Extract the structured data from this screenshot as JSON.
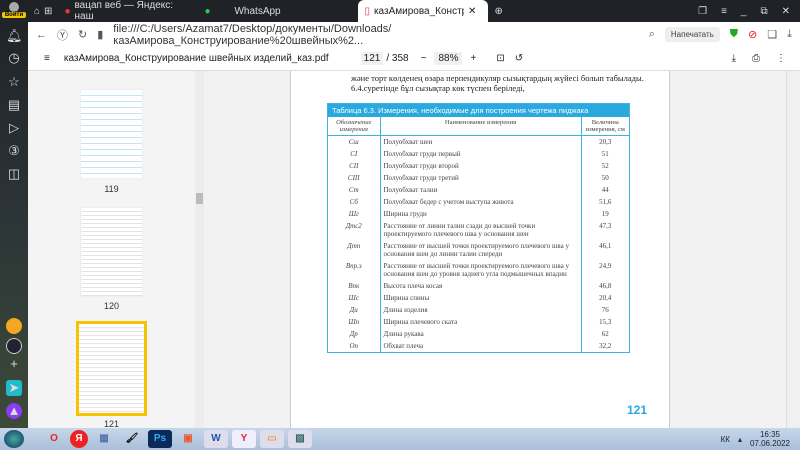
{
  "browser": {
    "login_label": "Войти",
    "tabs": [
      {
        "label": "вацап веб — Яндекс: наш"
      },
      {
        "label": "WhatsApp"
      },
      {
        "label": "казАмирова_Конструир"
      }
    ],
    "tab_count_badge": "3",
    "url": "file:///C:/Users/Azamat7/Desktop/документы/Downloads/казАмирова_Конструирование%20швейных%2...",
    "print_label": "Напечатать"
  },
  "pdf": {
    "filename": "казАмирова_Конструирование швейных изделий_каз.pdf",
    "page_current": "121",
    "page_total": "/ 358",
    "zoom": "88%"
  },
  "thumbnails": [
    {
      "label": "119"
    },
    {
      "label": "120"
    },
    {
      "label": "121",
      "selected": true
    }
  ],
  "page": {
    "text_line1": "және торт көлденең өзара перпендикуляр сызықтардың жүйесі болып табылады.",
    "text_line2": "6.4.суретінде бұл сызықтар көк түспен беріледі,",
    "table_caption": "Таблица 6.3. Измерения, необходимые для построения чертежа пиджака",
    "headers": [
      "Обозначение измерения",
      "Наименование измерения",
      "Величина измерения, см"
    ],
    "rows": [
      [
        "Сш",
        "Полуобхват шеи",
        "20,3"
      ],
      [
        "СI",
        "Полуобхват груди первый",
        "51"
      ],
      [
        "СII",
        "Полуобхват груди второй",
        "52"
      ],
      [
        "СIII",
        "Полуобхват груди третий",
        "50"
      ],
      [
        "Ст",
        "Полуобхват талии",
        "44"
      ],
      [
        "Сб",
        "Полуобхват бедер с учетом выступа живота",
        "51,6"
      ],
      [
        "Шг",
        "Ширина груди",
        "19"
      ],
      [
        "Дтс2",
        "Расстояние от линии талии сзади до высшей точки проектируемого плечевого шва у основания шеи",
        "47,3"
      ],
      [
        "Дтп",
        "Расстояние от высшей точки проектируемого плечевого шва у основания шеи до линии талии спереди",
        "46,1"
      ],
      [
        "Впр.з",
        "Расстояние от высшей точки проектируемого плечевого шва у основания шеи до уровня заднего угла подмышечных впадин",
        "24,9"
      ],
      [
        "Впк",
        "Высота плеча косая",
        "46,8"
      ],
      [
        "Шс",
        "Ширина спины",
        "20,4"
      ],
      [
        "Ди",
        "Длина изделия",
        "76"
      ],
      [
        "Шп",
        "Ширина плечевого ската",
        "15,3"
      ],
      [
        "Др",
        "Длина рукава",
        "62"
      ],
      [
        "Оп",
        "Обхват плеча",
        "32,2"
      ]
    ],
    "page_number": "121"
  },
  "taskbar": {
    "lang": "КК",
    "time": "16:35",
    "date": "07.06.2022"
  }
}
